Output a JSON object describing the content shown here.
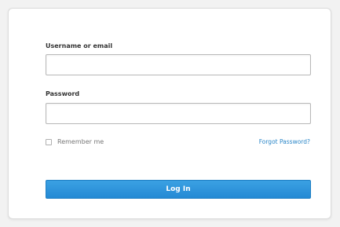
{
  "form": {
    "username_label": "Username or email",
    "username_value": "",
    "password_label": "Password",
    "password_value": "",
    "remember_label": "Remember me",
    "remember_checked": false,
    "forgot_label": "Forgot Password?",
    "submit_label": "Log In"
  },
  "colors": {
    "accent": "#2a8bd6",
    "link": "#2a86c8",
    "background": "#f2f2f2",
    "card": "#ffffff"
  }
}
